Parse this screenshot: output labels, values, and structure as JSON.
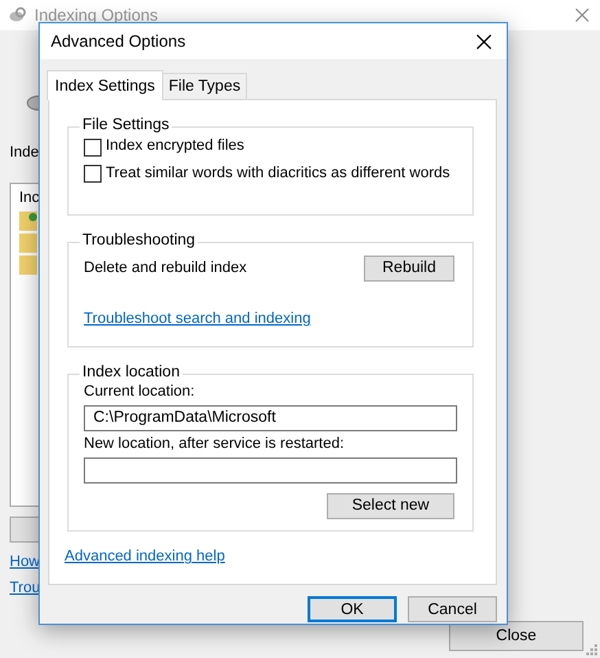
{
  "background_window": {
    "title": "Indexing Options",
    "label": "Inde",
    "list_header": "Inc",
    "links": [
      "How",
      "Trou"
    ],
    "close_button": "Close"
  },
  "dialog": {
    "title": "Advanced Options",
    "tabs": [
      {
        "label": "Index Settings",
        "selected": true
      },
      {
        "label": "File Types",
        "selected": false
      }
    ],
    "file_settings": {
      "legend": "File Settings",
      "options": [
        {
          "label": "Index encrypted files",
          "checked": false
        },
        {
          "label": "Treat similar words with diacritics as different words",
          "checked": false
        }
      ]
    },
    "troubleshooting": {
      "legend": "Troubleshooting",
      "text": "Delete and rebuild index",
      "button": "Rebuild",
      "link": "Troubleshoot search and indexing"
    },
    "index_location": {
      "legend": "Index location",
      "current_label": "Current location:",
      "current_value": "C:\\ProgramData\\Microsoft",
      "new_label": "New location, after service is restarted:",
      "button": "Select new"
    },
    "help_link": "Advanced indexing help",
    "buttons": [
      {
        "label": "OK",
        "default": true
      },
      {
        "label": "Cancel",
        "default": false
      }
    ]
  }
}
